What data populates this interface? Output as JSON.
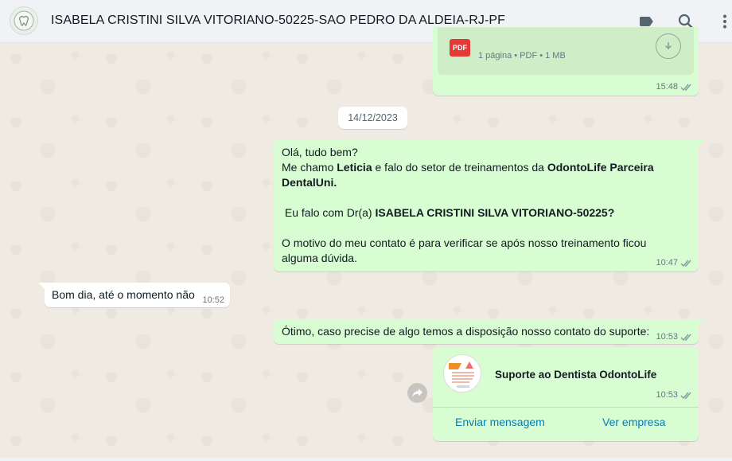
{
  "chat": {
    "title": "ISABELA CRISTINI SILVA VITORIANO-50225-SAO PEDRO DA ALDEIA-RJ-PF"
  },
  "file_message": {
    "file_type_badge": "PDF",
    "meta_text": "1 página • PDF • 1 MB",
    "time": "15:48"
  },
  "date_divider": "14/12/2023",
  "message1": {
    "line1": "Olá, tudo bem?",
    "line2_pre": "Me chamo ",
    "line2_name": "Leticia",
    "line2_mid": " e falo do setor de treinamentos  da ",
    "line2_company": "OdontoLife Parceira DentalUni.",
    "line3_pre": " Eu falo com Dr(a) ",
    "line3_person": "ISABELA CRISTINI SILVA VITORIANO-50225?",
    "line4": "O motivo do meu contato é para verificar se após nosso treinamento ficou alguma dúvida.",
    "time": "10:47"
  },
  "message2": {
    "text": "Bom dia, até o momento não",
    "time": "10:52"
  },
  "message3": {
    "text": "Ótimo, caso precise de algo temos a disposição nosso contato do suporte:",
    "time": "10:53"
  },
  "contact_card": {
    "name": "Suporte ao Dentista OdontoLife",
    "time": "10:53",
    "action_message": "Enviar mensagem",
    "action_business": "Ver empresa"
  },
  "icons": {
    "avatar": "tooth-logo-icon",
    "label": "label-icon",
    "search": "search-icon",
    "menu": "more-vertical-icon",
    "download": "download-icon",
    "forward": "forward-icon",
    "ticks": "double-check-icon"
  },
  "colors": {
    "outgoing_bubble": "#d9fdd3",
    "incoming_bubble": "#ffffff",
    "background": "#efeae2",
    "link": "#027eb5",
    "read_ticks": "#8696a0"
  }
}
